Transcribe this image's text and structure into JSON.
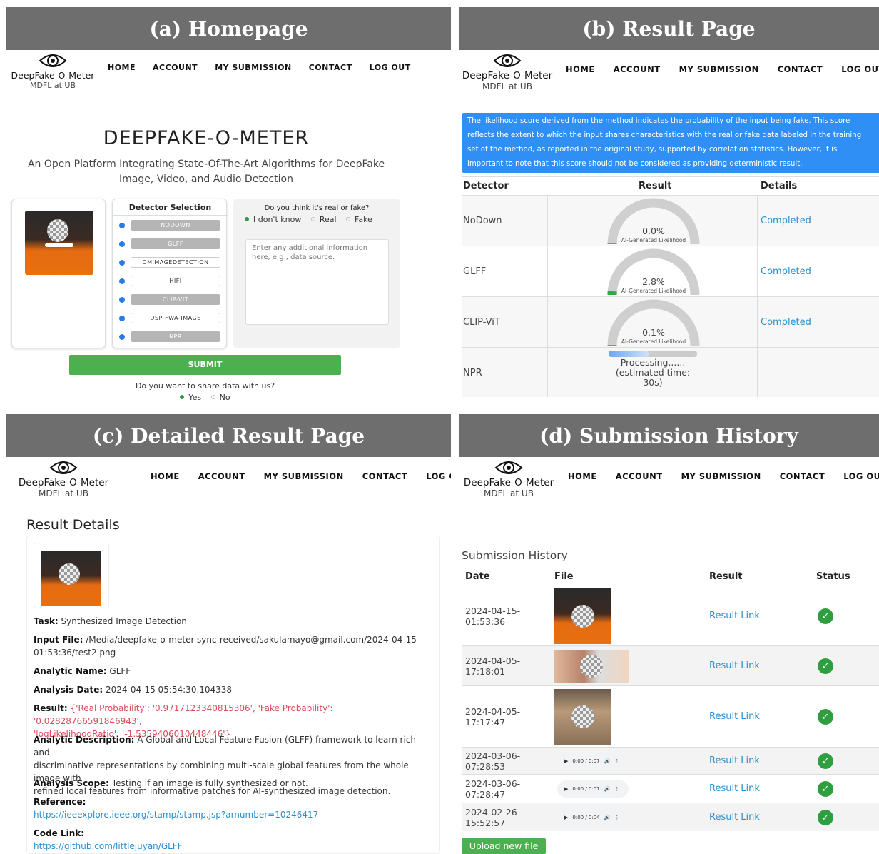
{
  "brand": {
    "name": "DeepFake-O-Meter",
    "sub": "MDFL at UB"
  },
  "nav": [
    "HOME",
    "ACCOUNT",
    "MY SUBMISSION",
    "CONTACT",
    "LOG OUT"
  ],
  "panel_a": {
    "title": "(a) Homepage",
    "hero_title": "DEEPFAKE-O-METER",
    "hero_sub_1": "An Open Platform Integrating State-Of-The-Art Algorithms for DeepFake",
    "hero_sub_2": "Image, Video, and Audio Detection",
    "detector_heading": "Detector Selection",
    "detectors": [
      {
        "label": "NODOWN",
        "selected": true
      },
      {
        "label": "GLFF",
        "selected": true
      },
      {
        "label": "DMIMAGEDETECTION",
        "selected": false
      },
      {
        "label": "HIFI",
        "selected": false
      },
      {
        "label": "CLIP-VIT",
        "selected": true
      },
      {
        "label": "DSP-FWA-IMAGE",
        "selected": false
      },
      {
        "label": "NPR",
        "selected": true
      }
    ],
    "question": "Do you think it's real or fake?",
    "options": [
      "I don't know",
      "Real",
      "Fake"
    ],
    "textarea_placeholder_1": "Enter any additional information",
    "textarea_placeholder_2": "here, e.g., data source.",
    "submit": "SUBMIT",
    "share_q": "Do you want to share data with us?",
    "share_options": [
      "Yes",
      "No"
    ]
  },
  "panel_b": {
    "title": "(b) Result Page",
    "notice": "The likelihood score derived from the method indicates the probability of the input being fake. This score reflects the extent to which the input shares characteristics with the real or fake data labeled in the training set of the method, as reported in the original study, supported by correlation statistics. However, it is important to note that this score should not be considered as providing deterministic result.",
    "headers": [
      "Detector",
      "Result",
      "Details"
    ],
    "gauge_caption": "AI-Generated Likelihood",
    "rows": [
      {
        "detector": "NoDown",
        "result": "0.0%",
        "value": 0.0,
        "details": "Completed"
      },
      {
        "detector": "GLFF",
        "result": "2.8%",
        "value": 2.8,
        "details": "Completed"
      },
      {
        "detector": "CLIP-ViT",
        "result": "0.1%",
        "value": 0.1,
        "details": "Completed"
      }
    ],
    "npr": {
      "detector": "NPR",
      "line1": "Processing......",
      "line2": "(estimated time:",
      "line3": "30s)"
    }
  },
  "panel_c": {
    "title": "(c) Detailed Result Page",
    "heading": "Result Details",
    "task_k": "Task:",
    "task_v": "Synthesized Image Detection",
    "input_k": "Input File:",
    "input_v1": "/Media/deepfake-o-meter-sync-received/sakulamayo@gmail.com/2024-04-15-",
    "input_v2": "01:53:36/test2.png",
    "name_k": "Analytic Name:",
    "name_v": "GLFF",
    "date_k": "Analysis Date:",
    "date_v": "2024-04-15 05:54:30.104338",
    "result_k": "Result:",
    "result_v1": "{'Real Probability': '0.9717123340815306', 'Fake Probability': '0.02828766591846943',",
    "result_v2": "'logLikelihoodRatio': '-1.5359406010448446'}",
    "desc_k": "Analytic Description:",
    "desc_v1": "A Global and Local Feature Fusion (GLFF) framework to learn rich and",
    "desc_v2": "discriminative representations by combining multi-scale global features from the whole image with",
    "desc_v3": "refined local features from informative patches for AI-synthesized image detection.",
    "scope_k": "Analysis Scope:",
    "scope_v": "Testing if an image is fully synthesized or not.",
    "ref_k": "Reference:",
    "ref_v": "https://ieeexplore.ieee.org/stamp/stamp.jsp?arnumber=10246417",
    "code_k": "Code Link:",
    "code_v": "https://github.com/littlejuyan/GLFF"
  },
  "panel_d": {
    "title": "(d) Submission History",
    "heading": "Submission History",
    "headers": [
      "Date",
      "File",
      "Result",
      "Status"
    ],
    "rows": [
      {
        "date1": "2024-04-15-",
        "date2": "01:53:36",
        "type": "image",
        "result": "Result Link"
      },
      {
        "date1": "2024-04-05-",
        "date2": "17:18:01",
        "type": "image",
        "result": "Result Link"
      },
      {
        "date1": "2024-04-05-",
        "date2": "17:17:47",
        "type": "image",
        "result": "Result Link"
      },
      {
        "date1": "2024-03-06-",
        "date2": "07:28:53",
        "type": "audio",
        "audio": "0:00 / 0:07",
        "result": "Result Link"
      },
      {
        "date1": "2024-03-06-",
        "date2": "07:28:47",
        "type": "audio",
        "audio": "0:00 / 0:07",
        "result": "Result Link"
      },
      {
        "date1": "2024-02-26-",
        "date2": "15:52:57",
        "type": "audio",
        "audio": "0:00 / 0:04",
        "result": "Result Link"
      }
    ],
    "upload": "Upload new file"
  },
  "colors": {
    "green": "#4caf50",
    "blue_notice": "#2f8ff5",
    "link": "#2c8fcf",
    "check": "#2e9e3e",
    "header_gray": "#6e6e6e"
  }
}
